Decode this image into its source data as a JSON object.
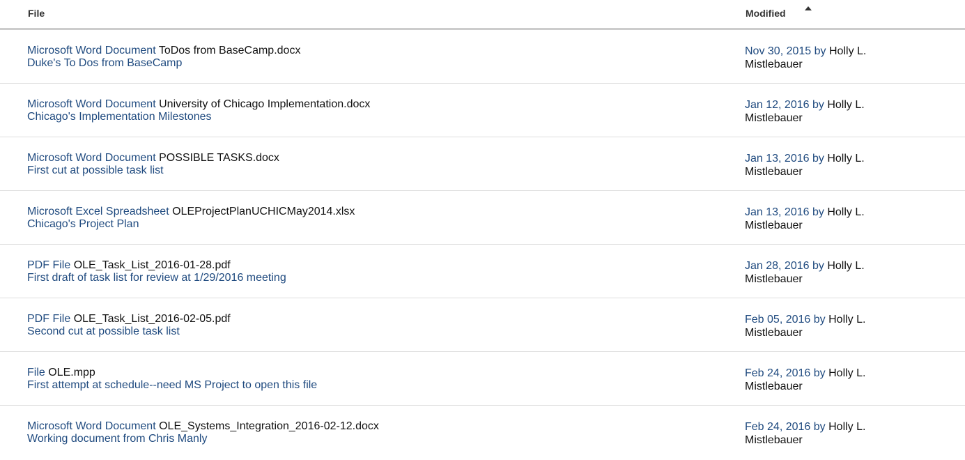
{
  "header": {
    "file_label": "File",
    "modified_label": "Modified",
    "sort_icon": "sort-ascending-icon"
  },
  "rows": [
    {
      "type_label": "Microsoft Word Document",
      "filename": "ToDos from BaseCamp.docx",
      "comment": "Duke's To Dos from BaseCamp",
      "date": "Nov 30, 2015",
      "by": "by",
      "author_first": "Holly L.",
      "author_last": "Mistlebauer"
    },
    {
      "type_label": "Microsoft Word Document",
      "filename": "University of Chicago Implementation.docx",
      "comment": "Chicago's Implementation Milestones",
      "date": "Jan 12, 2016",
      "by": "by",
      "author_first": "Holly L.",
      "author_last": "Mistlebauer"
    },
    {
      "type_label": "Microsoft Word Document",
      "filename": "POSSIBLE TASKS.docx",
      "comment": "First cut at possible task list",
      "date": "Jan 13, 2016",
      "by": "by",
      "author_first": "Holly L.",
      "author_last": "Mistlebauer"
    },
    {
      "type_label": "Microsoft Excel Spreadsheet",
      "filename": "OLEProjectPlanUCHICMay2014.xlsx",
      "comment": "Chicago's Project Plan",
      "date": "Jan 13, 2016",
      "by": "by",
      "author_first": "Holly L.",
      "author_last": "Mistlebauer"
    },
    {
      "type_label": "PDF File",
      "filename": "OLE_Task_List_2016-01-28.pdf",
      "comment": "First draft of task list for review at 1/29/2016 meeting",
      "date": "Jan 28, 2016",
      "by": "by",
      "author_first": "Holly L.",
      "author_last": "Mistlebauer"
    },
    {
      "type_label": "PDF File",
      "filename": "OLE_Task_List_2016-02-05.pdf",
      "comment": "Second cut at possible task list",
      "date": "Feb 05, 2016",
      "by": "by",
      "author_first": "Holly L.",
      "author_last": "Mistlebauer"
    },
    {
      "type_label": "File",
      "filename": "OLE.mpp",
      "comment": "First attempt at schedule--need MS Project to open this file",
      "date": "Feb 24, 2016",
      "by": "by",
      "author_first": "Holly L.",
      "author_last": "Mistlebauer"
    },
    {
      "type_label": "Microsoft Word Document",
      "filename": "OLE_Systems_Integration_2016-02-12.docx",
      "comment": "Working document from Chris Manly",
      "date": "Feb 24, 2016",
      "by": "by",
      "author_first": "Holly L.",
      "author_last": "Mistlebauer"
    }
  ]
}
